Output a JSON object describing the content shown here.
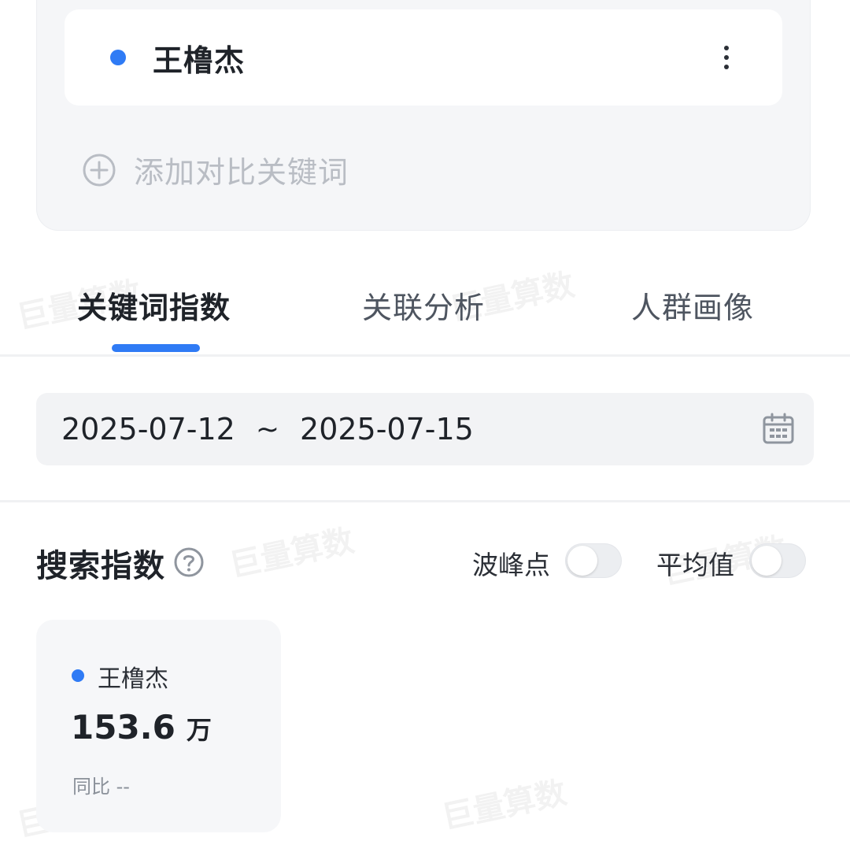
{
  "colors": {
    "accent": "#2f7bf5",
    "tab_underline": "#2f7bf5",
    "muted_icon": "#b9bdc4"
  },
  "keywords": [
    {
      "name": "王橹杰",
      "color": "#2f7bf5"
    }
  ],
  "add_keyword": {
    "label": "添加对比关键词",
    "icon": "plus-circle-icon"
  },
  "tabs": [
    {
      "label": "关键词指数",
      "active": true
    },
    {
      "label": "关联分析",
      "active": false
    },
    {
      "label": "人群画像",
      "active": false
    }
  ],
  "date_range": {
    "start": "2025-07-12",
    "separator": "~",
    "end": "2025-07-15",
    "icon": "calendar-icon"
  },
  "search_index": {
    "title": "搜索指数",
    "help_icon": "question-circle-icon",
    "toggles": [
      {
        "label": "波峰点",
        "on": false
      },
      {
        "label": "平均值",
        "on": false
      }
    ]
  },
  "metric": {
    "keyword": "王橹杰",
    "value": "153.6",
    "unit": "万",
    "yoy_label": "同比",
    "yoy_value": "--"
  },
  "watermark": "巨量算数"
}
